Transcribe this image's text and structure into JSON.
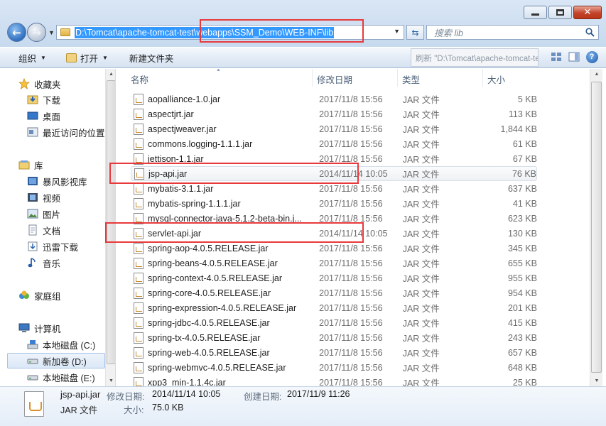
{
  "window": {
    "address": "D:\\Tomcat\\apache-tomcat-test\\webapps\\SSM_Demo\\WEB-INF\\lib",
    "search_placeholder": "搜索 lib"
  },
  "toolbar": {
    "organize": "组织",
    "open": "打开",
    "new_folder": "新建文件夹",
    "tooltip": "刷新 \"D:\\Tomcat\\apache-tomcat-test\\webapps\""
  },
  "sidebar": {
    "favorites": {
      "label": "收藏夹",
      "items": [
        "下载",
        "桌面",
        "最近访问的位置"
      ]
    },
    "libraries": {
      "label": "库",
      "items": [
        "暴风影视库",
        "视频",
        "图片",
        "文档",
        "迅雷下载",
        "音乐"
      ]
    },
    "homegroup": "家庭组",
    "computer": {
      "label": "计算机",
      "items": [
        "本地磁盘 (C:)",
        "新加卷 (D:)",
        "本地磁盘 (E:)"
      ]
    }
  },
  "columns": {
    "name": "名称",
    "date": "修改日期",
    "type": "类型",
    "size": "大小"
  },
  "files": [
    {
      "name": "aopalliance-1.0.jar",
      "date": "2017/11/8 15:56",
      "type": "JAR 文件",
      "size": "5 KB"
    },
    {
      "name": "aspectjrt.jar",
      "date": "2017/11/8 15:56",
      "type": "JAR 文件",
      "size": "113 KB"
    },
    {
      "name": "aspectjweaver.jar",
      "date": "2017/11/8 15:56",
      "type": "JAR 文件",
      "size": "1,844 KB"
    },
    {
      "name": "commons.logging-1.1.1.jar",
      "date": "2017/11/8 15:56",
      "type": "JAR 文件",
      "size": "61 KB"
    },
    {
      "name": "jettison-1.1.jar",
      "date": "2017/11/8 15:56",
      "type": "JAR 文件",
      "size": "67 KB"
    },
    {
      "name": "jsp-api.jar",
      "date": "2014/11/14 10:05",
      "type": "JAR 文件",
      "size": "76 KB"
    },
    {
      "name": "mybatis-3.1.1.jar",
      "date": "2017/11/8 15:56",
      "type": "JAR 文件",
      "size": "637 KB"
    },
    {
      "name": "mybatis-spring-1.1.1.jar",
      "date": "2017/11/8 15:56",
      "type": "JAR 文件",
      "size": "41 KB"
    },
    {
      "name": "mysql-connector-java-5.1.2-beta-bin.j...",
      "date": "2017/11/8 15:56",
      "type": "JAR 文件",
      "size": "623 KB"
    },
    {
      "name": "servlet-api.jar",
      "date": "2014/11/14 10:05",
      "type": "JAR 文件",
      "size": "130 KB"
    },
    {
      "name": "spring-aop-4.0.5.RELEASE.jar",
      "date": "2017/11/8 15:56",
      "type": "JAR 文件",
      "size": "345 KB"
    },
    {
      "name": "spring-beans-4.0.5.RELEASE.jar",
      "date": "2017/11/8 15:56",
      "type": "JAR 文件",
      "size": "655 KB"
    },
    {
      "name": "spring-context-4.0.5.RELEASE.jar",
      "date": "2017/11/8 15:56",
      "type": "JAR 文件",
      "size": "955 KB"
    },
    {
      "name": "spring-core-4.0.5.RELEASE.jar",
      "date": "2017/11/8 15:56",
      "type": "JAR 文件",
      "size": "954 KB"
    },
    {
      "name": "spring-expression-4.0.5.RELEASE.jar",
      "date": "2017/11/8 15:56",
      "type": "JAR 文件",
      "size": "201 KB"
    },
    {
      "name": "spring-jdbc-4.0.5.RELEASE.jar",
      "date": "2017/11/8 15:56",
      "type": "JAR 文件",
      "size": "415 KB"
    },
    {
      "name": "spring-tx-4.0.5.RELEASE.jar",
      "date": "2017/11/8 15:56",
      "type": "JAR 文件",
      "size": "243 KB"
    },
    {
      "name": "spring-web-4.0.5.RELEASE.jar",
      "date": "2017/11/8 15:56",
      "type": "JAR 文件",
      "size": "657 KB"
    },
    {
      "name": "spring-webmvc-4.0.5.RELEASE.jar",
      "date": "2017/11/8 15:56",
      "type": "JAR 文件",
      "size": "648 KB"
    },
    {
      "name": "xpp3_min-1.1.4c.jar",
      "date": "2017/11/8 15:56",
      "type": "JAR 文件",
      "size": "25 KB"
    }
  ],
  "details": {
    "name": "jsp-api.jar",
    "type": "JAR 文件",
    "modified_label": "修改日期:",
    "modified": "2014/11/14 10:05",
    "created_label": "创建日期:",
    "created": "2017/11/9 11:26",
    "size_label": "大小:",
    "size": "75.0 KB"
  }
}
